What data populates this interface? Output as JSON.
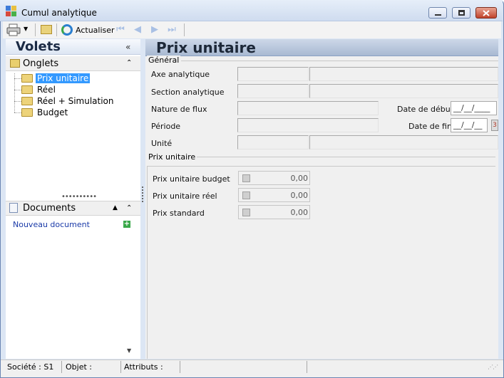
{
  "window": {
    "title": "Cumul analytique"
  },
  "toolbar": {
    "refresh_label": "Actualiser"
  },
  "left_pane": {
    "title": "Volets",
    "collapse_glyph": "«",
    "tabs_section": {
      "label": "Onglets",
      "toggle_glyph": "⌃",
      "items": [
        {
          "label": "Prix unitaire",
          "selected": true
        },
        {
          "label": "Réel",
          "selected": false
        },
        {
          "label": "Réel + Simulation",
          "selected": false
        },
        {
          "label": "Budget",
          "selected": false
        }
      ]
    },
    "docs_section": {
      "label": "Documents",
      "toggle_glyph": "⌃",
      "new_document": "Nouveau document"
    }
  },
  "main": {
    "title": "Prix unitaire",
    "general": {
      "title": "Général",
      "axe_label": "Axe analytique",
      "section_label": "Section analytique",
      "nature_label": "Nature de flux",
      "periode_label": "Période",
      "unite_label": "Unité",
      "date_debut_label": "Date de début",
      "date_fin_label": "Date de fin",
      "date_debut_value": "__/__/____",
      "date_fin_value": "__/__/__"
    },
    "prix": {
      "title": "Prix unitaire",
      "budget_label": "Prix unitaire budget",
      "budget_value": "0,00",
      "reel_label": "Prix unitaire réel",
      "reel_value": "0,00",
      "standard_label": "Prix standard",
      "standard_value": "0,00"
    }
  },
  "status_bar": {
    "societe": "Société : S1",
    "objet": "Objet :",
    "attributs": "Attributs :"
  },
  "colors": {
    "selection": "#3399ff",
    "header_gradient_end": "#a8b9d2"
  },
  "icons": [
    "app-icon",
    "printer-icon",
    "folder-icon",
    "refresh-icon",
    "first-icon",
    "prev-icon",
    "next-icon",
    "last-icon",
    "calendar-icon",
    "add-icon"
  ]
}
